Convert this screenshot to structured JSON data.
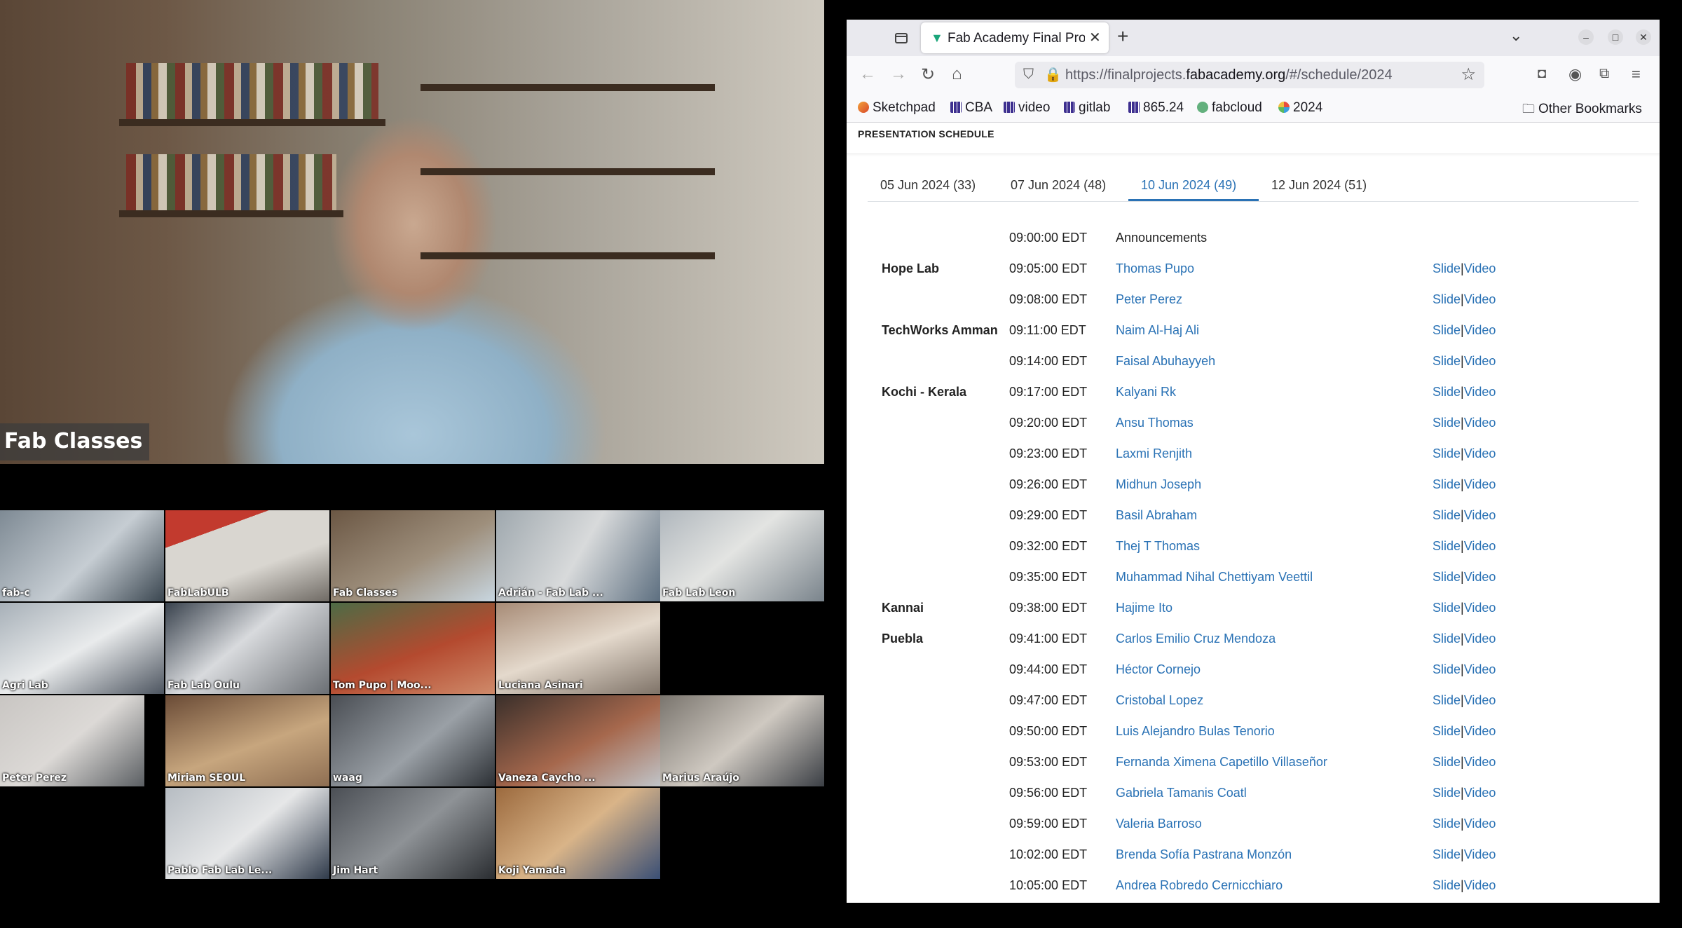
{
  "call": {
    "speaker_label": "Fab Classes",
    "gallery": [
      "fab-c",
      "FabLabULB",
      "Fab Classes",
      "Adrián - Fab Lab ...",
      "Fab Lab Leon",
      "Agri Lab",
      "Fab Lab Oulu",
      "Tom Pupo | Moo...",
      "Luciana Asinari",
      "Peter Perez",
      "Miriam SEOUL",
      "waag",
      "Vaneza Caycho ...",
      "Marius Araújo",
      "Pablo Fab Lab Le...",
      "Jim Hart",
      "Koji Yamada"
    ]
  },
  "browser": {
    "tab_title": "Fab Academy Final Pro",
    "url": {
      "prefix": "https://finalprojects.",
      "domain": "fabacademy.org",
      "suffix": "/#/schedule/2024"
    },
    "bookmarks": [
      "Sketchpad",
      "CBA",
      "video",
      "gitlab",
      "865.24",
      "fabcloud",
      "2024"
    ],
    "other_bookmarks": "Other Bookmarks"
  },
  "page": {
    "title": "PRESENTATION SCHEDULE",
    "date_tabs": [
      {
        "label": "05 Jun 2024 (33)",
        "active": false
      },
      {
        "label": "07 Jun 2024 (48)",
        "active": false
      },
      {
        "label": "10 Jun 2024 (49)",
        "active": true
      },
      {
        "label": "12 Jun 2024 (51)",
        "active": false
      }
    ],
    "slide_label": "Slide",
    "separator": "|",
    "video_label": "Video",
    "schedule": [
      {
        "lab": "",
        "time": "09:00:00 EDT",
        "name": "Announcements",
        "links": false
      },
      {
        "lab": "Hope Lab",
        "time": "09:05:00 EDT",
        "name": "Thomas Pupo",
        "links": true
      },
      {
        "lab": "",
        "time": "09:08:00 EDT",
        "name": "Peter Perez",
        "links": true
      },
      {
        "lab": "TechWorks Amman",
        "time": "09:11:00 EDT",
        "name": "Naim Al-Haj Ali",
        "links": true
      },
      {
        "lab": "",
        "time": "09:14:00 EDT",
        "name": "Faisal Abuhayyeh",
        "links": true
      },
      {
        "lab": "Kochi - Kerala",
        "time": "09:17:00 EDT",
        "name": "Kalyani Rk",
        "links": true
      },
      {
        "lab": "",
        "time": "09:20:00 EDT",
        "name": "Ansu Thomas",
        "links": true
      },
      {
        "lab": "",
        "time": "09:23:00 EDT",
        "name": "Laxmi Renjith",
        "links": true
      },
      {
        "lab": "",
        "time": "09:26:00 EDT",
        "name": "Midhun Joseph",
        "links": true
      },
      {
        "lab": "",
        "time": "09:29:00 EDT",
        "name": "Basil Abraham",
        "links": true
      },
      {
        "lab": "",
        "time": "09:32:00 EDT",
        "name": "Thej T Thomas",
        "links": true
      },
      {
        "lab": "",
        "time": "09:35:00 EDT",
        "name": "Muhammad Nihal Chettiyam Veettil",
        "links": true
      },
      {
        "lab": "Kannai",
        "time": "09:38:00 EDT",
        "name": "Hajime Ito",
        "links": true
      },
      {
        "lab": "Puebla",
        "time": "09:41:00 EDT",
        "name": "Carlos Emilio Cruz Mendoza",
        "links": true
      },
      {
        "lab": "",
        "time": "09:44:00 EDT",
        "name": "Héctor Cornejo",
        "links": true
      },
      {
        "lab": "",
        "time": "09:47:00 EDT",
        "name": "Cristobal Lopez",
        "links": true
      },
      {
        "lab": "",
        "time": "09:50:00 EDT",
        "name": "Luis Alejandro Bulas Tenorio",
        "links": true
      },
      {
        "lab": "",
        "time": "09:53:00 EDT",
        "name": "Fernanda Ximena Capetillo Villaseñor",
        "links": true
      },
      {
        "lab": "",
        "time": "09:56:00 EDT",
        "name": "Gabriela Tamanis Coatl",
        "links": true
      },
      {
        "lab": "",
        "time": "09:59:00 EDT",
        "name": "Valeria Barroso",
        "links": true
      },
      {
        "lab": "",
        "time": "10:02:00 EDT",
        "name": "Brenda Sofía Pastrana Monzón",
        "links": true
      },
      {
        "lab": "",
        "time": "10:05:00 EDT",
        "name": "Andrea Robredo Cernicchiaro",
        "links": true
      }
    ]
  }
}
